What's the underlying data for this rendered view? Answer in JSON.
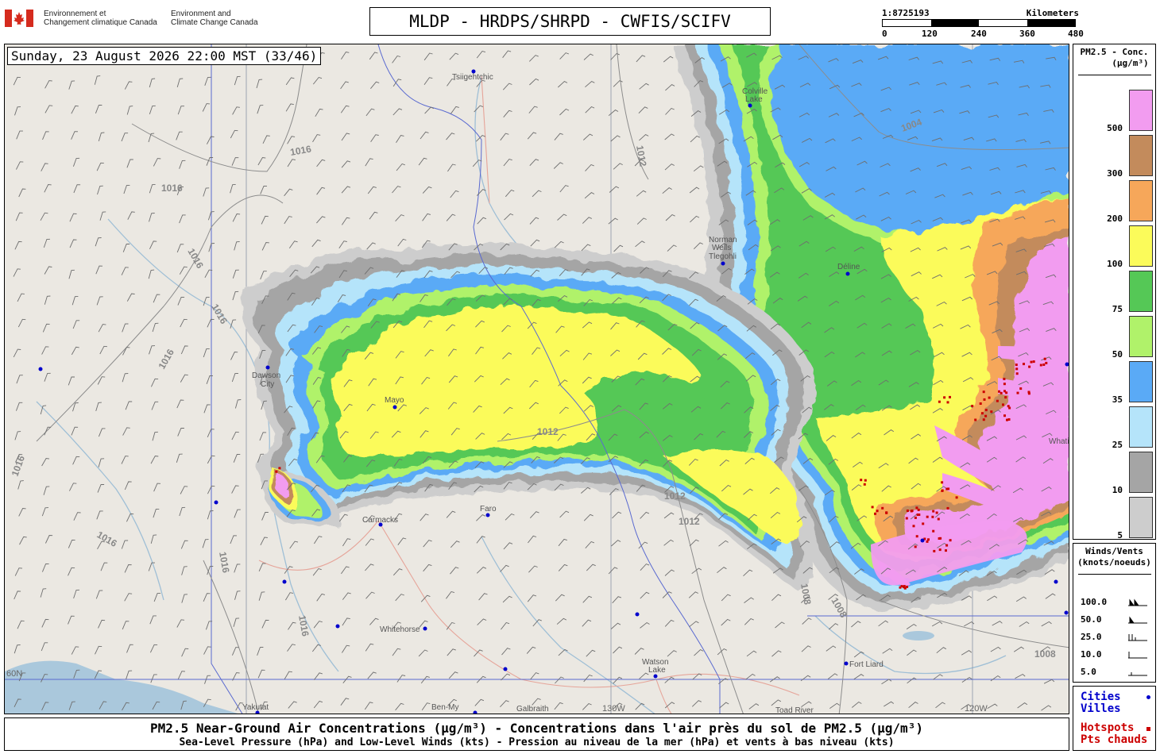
{
  "header": {
    "gov_fr_line1": "Environnement et",
    "gov_fr_line2": "Changement climatique Canada",
    "gov_en_line1": "Environment and",
    "gov_en_line2": "Climate Change Canada",
    "title": "MLDP - HRDPS/SHRPD - CWFIS/SCIFV",
    "scale_ratio": "1:8725193",
    "scale_unit": "Kilometers",
    "scale_ticks": [
      "0",
      "120",
      "240",
      "360",
      "480"
    ]
  },
  "map": {
    "timestamp": "Sunday, 23 August 2026 22:00 MST (33/46)",
    "cities": [
      "Tsiigehtchic",
      "Colville Lake",
      "Norman Wells / Tlegohli",
      "Déline",
      "Dawson City",
      "Mayo",
      "Carmacks",
      "Faro",
      "Whitehorse",
      "Watson Lake",
      "Fort Liard",
      "Yakutat",
      "Ben-My",
      "Galbraith",
      "Toad River",
      "Whati"
    ],
    "city_labels": {
      "tsiigehtchic": "Tsiigehtchic",
      "colville1": "Colville",
      "colville2": "Lake",
      "norman1": "Norman",
      "norman2": "Wells",
      "norman3": "Tlegohli",
      "deline": "Déline",
      "dawson1": "Dawson",
      "dawson2": "City",
      "mayo": "Mayo",
      "carmacks": "Carmacks",
      "faro": "Faro",
      "whitehorse": "Whitehorse",
      "watson1": "Watson",
      "watson2": "Lake",
      "fortliard": "Fort Liard",
      "yakutat": "Yakutat",
      "benmy": "Ben-My",
      "galbraith": "Galbraith",
      "toadriver": "Toad River",
      "whati": "Whati"
    },
    "isobars": {
      "i1016": "1016",
      "i1012": "1012",
      "i1008": "1008",
      "i1004": "1004"
    },
    "meridians": {
      "m130": "130W",
      "m120": "120W",
      "p60": "60N"
    }
  },
  "legend_pm": {
    "title_line1": "PM2.5 - Conc.",
    "title_line2": "(µg/m³)",
    "levels": [
      {
        "label": "500",
        "color": "#f29cf0"
      },
      {
        "label": "300",
        "color": "#c38b5c"
      },
      {
        "label": "200",
        "color": "#f6a75a"
      },
      {
        "label": "100",
        "color": "#fbfb5a"
      },
      {
        "label": "75",
        "color": "#55c856"
      },
      {
        "label": "50",
        "color": "#b0f26a"
      },
      {
        "label": "35",
        "color": "#5aaaf6"
      },
      {
        "label": "25",
        "color": "#b5e4fa"
      },
      {
        "label": "10",
        "color": "#a5a5a5"
      },
      {
        "label": "5",
        "color": "#cdcdcd"
      }
    ]
  },
  "legend_wind": {
    "title_line1": "Winds/Vents",
    "title_line2": "(knots/noeuds)",
    "speeds": [
      "100.0",
      "50.0",
      "25.0",
      "10.0",
      "5.0"
    ]
  },
  "legend_symbols": {
    "cities_line1": "Cities",
    "cities_line2": "Villes",
    "hot_line1": "Hotspots",
    "hot_line2": "Pts chauds"
  },
  "caption": {
    "line1": "PM2.5 Near-Ground Air Concentrations (µg/m³) - Concentrations dans l'air près du sol de PM2.5 (µg/m³)",
    "line2": "Sea-Level Pressure (hPa) and Low-Level Winds (kts) - Pression au niveau de la mer (hPa) et vents à bas niveau (kts)"
  },
  "colors": {
    "land": "#ebe8e2",
    "water": "#aac8dc",
    "border": "#5a6ad0",
    "isobar": "#7d7d7d",
    "city": "#0000cc",
    "hotspot": "#cc0000"
  }
}
